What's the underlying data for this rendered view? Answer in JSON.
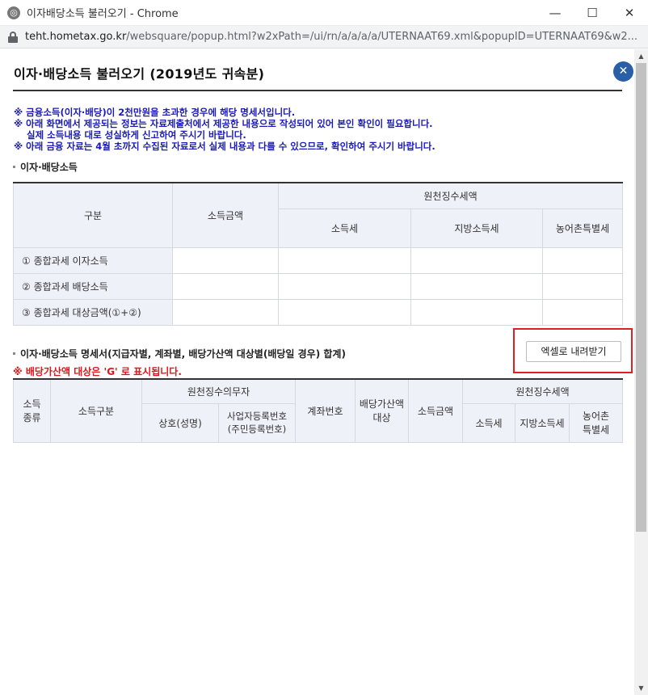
{
  "window": {
    "title": "이자배당소득 불러오기 - Chrome",
    "icon_glyph": "◎",
    "controls": {
      "minimize": "—",
      "maximize": "☐",
      "close": "✕"
    }
  },
  "address_bar": {
    "host": "teht.hometax.go.kr",
    "path": "/websquare/popup.html?w2xPath=/ui/rn/a/a/a/a/UTERNAAT69.xml&popupID=UTERNAAT69&w2..."
  },
  "popup": {
    "title": "이자·배당소득 불러오기 (2019년도 귀속분)",
    "close_glyph": "✕"
  },
  "notes": [
    "※ 금융소득(이자·배당)이 2천만원을 초과한 경우에 해당 명세서입니다.",
    "※ 아래 화면에서 제공되는 정보는 자료제출처에서 제공한 내용으로 작성되어 있어 본인 확인이 필요합니다.",
    "실제 소득내용 대로 성실하게 신고하여 주시기 바랍니다.",
    "※ 아래 금융 자료는 4월 초까지 수집된 자료로서 실제 내용과 다를 수 있으므로, 확인하여 주시기 바랍니다."
  ],
  "section1": {
    "title": "이자·배당소득",
    "headers": {
      "category": "구분",
      "income_amount": "소득금액",
      "withholding_tax": "원천징수세액",
      "income_tax": "소득세",
      "local_income_tax": "지방소득세",
      "rural_special_tax": "농어촌특별세"
    },
    "rows": [
      {
        "label": "① 종합과세 이자소득"
      },
      {
        "label": "② 종합과세 배당소득"
      },
      {
        "label": "③ 종합과세 대상금액(①+②)"
      }
    ]
  },
  "section2": {
    "title": "이자·배당소득 명세서(지급자별, 계좌별, 배당가산액 대상별(배당일 경우) 합계)",
    "excel_button": "엑셀로 내려받기",
    "red_note": "※ 배당가산액 대상은 'G' 로 표시됩니다.",
    "headers": {
      "income_type": "소득\n종류",
      "income_category": "소득구분",
      "withholding_agent": "원천징수의무자",
      "trade_name": "상호(성명)",
      "business_reg_no": "사업자등록번호\n(주민등록번호)",
      "account_no": "계좌번호",
      "dividend_grossup": "배당가산액\n대상",
      "income_amount": "소득금액",
      "withholding_tax": "원천징수세액",
      "income_tax": "소득세",
      "local_income_tax": "지방소득세",
      "rural_special_tax": "농어촌\n특별세"
    }
  },
  "colors": {
    "accent": "#2a5fa8",
    "notes": "#1a1ab8",
    "warning": "#e0151b",
    "header_bg": "#eef1f7",
    "highlight_box": "#e02020"
  }
}
